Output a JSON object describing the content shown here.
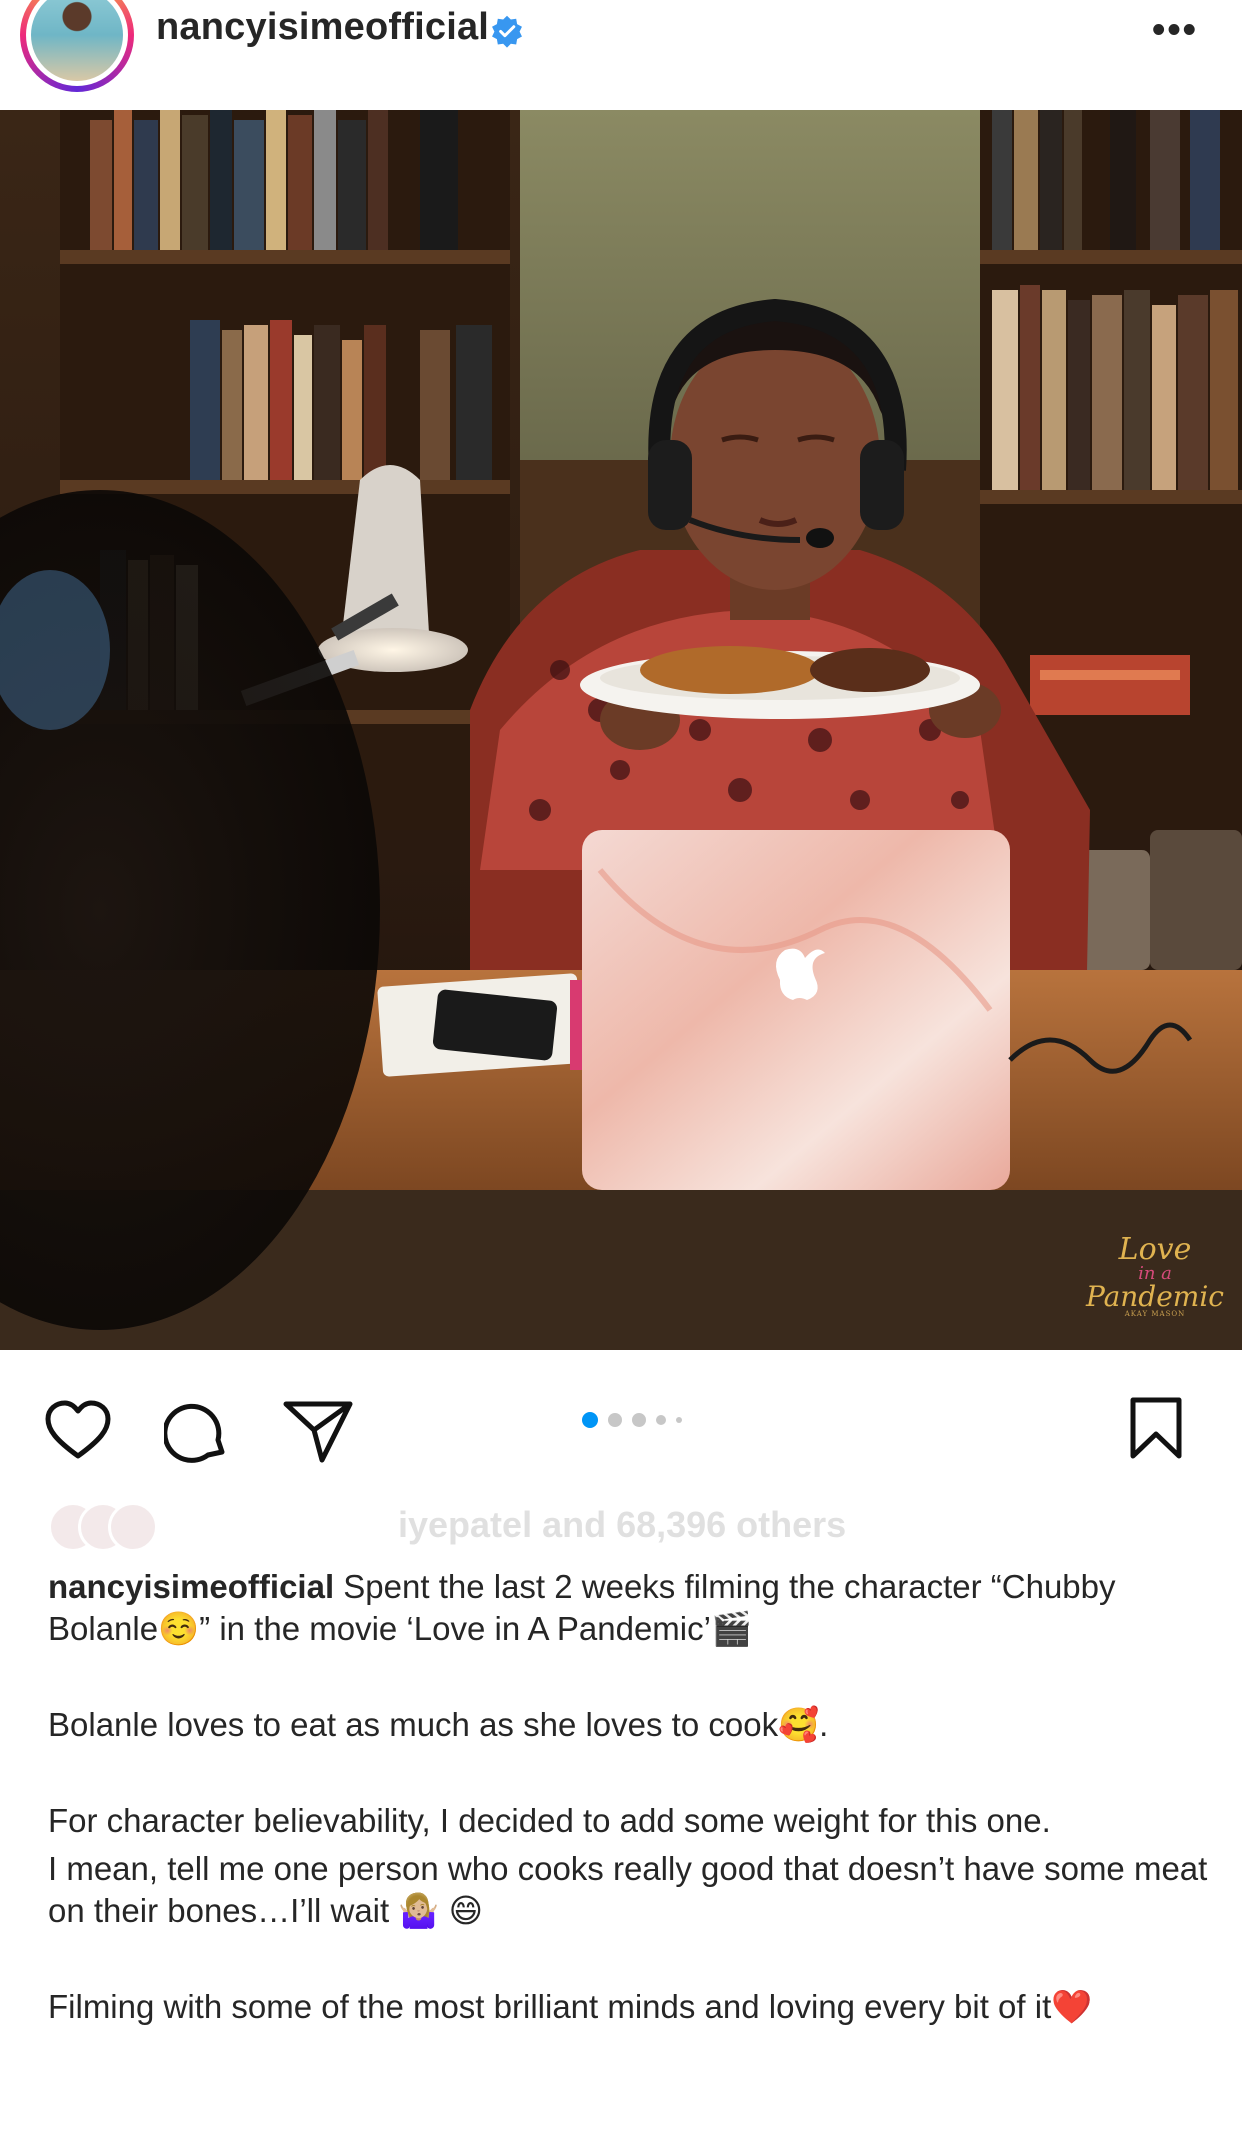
{
  "header": {
    "username": "nancyisimeofficial",
    "verified": true,
    "more_label": "•••"
  },
  "photo": {
    "watermark_line1": "Love",
    "watermark_line2": "in a",
    "watermark_line3": "Pandemic",
    "watermark_credit": "AKAY MASON"
  },
  "carousel": {
    "count": 5,
    "active_index": 0
  },
  "likes": {
    "text": "iyepatel and 68,396 others"
  },
  "caption": {
    "username": "nancyisimeofficial",
    "paragraph1": "Spent the last 2 weeks filming the character “Chubby Bolanle☺️” in the movie ‘Love in A Pandemic’🎬",
    "paragraph2": "Bolanle loves to eat as much as she loves to cook🥰.",
    "paragraph3": "For character believability, I decided to add some weight for this one.",
    "paragraph4": "I mean, tell me one person who cooks really good that doesn’t have some meat on their bones…I’ll wait 🤷🏼‍♀️ 😄",
    "paragraph5": "Filming with some of the most brilliant minds and loving every bit of it❤️"
  },
  "colors": {
    "accent_blue": "#0095f6",
    "text": "#262626",
    "verified": "#3897f0"
  },
  "icons": [
    "heart-icon",
    "comment-icon",
    "share-icon",
    "bookmark-icon",
    "verified-icon",
    "more-icon"
  ]
}
